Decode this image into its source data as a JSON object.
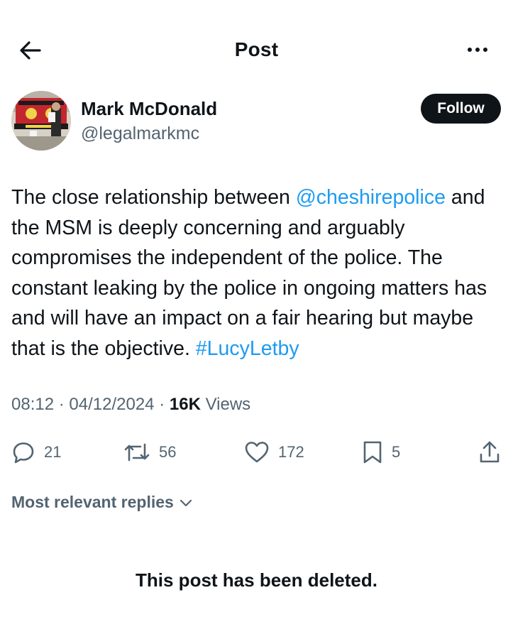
{
  "header": {
    "title": "Post",
    "back_icon": "arrow-left-icon",
    "more_icon": "more-horizontal-icon"
  },
  "author": {
    "name": "Mark McDonald",
    "handle": "@legalmarkmc",
    "follow_label": "Follow"
  },
  "post": {
    "text_part1": "The close relationship between ",
    "mention": "@cheshirepolice",
    "text_part2": " and the MSM is deeply concerning and arguably compromises the independent of the police. The constant leaking by the police in ongoing matters has and will have an impact on a fair hearing but maybe that is the objective. ",
    "hashtag": "#LucyLetby",
    "link_color": "#1d9bf0"
  },
  "meta": {
    "time": "08:12",
    "separator": "·",
    "date": "04/12/2024",
    "views_count": "16K",
    "views_label": "Views"
  },
  "actions": {
    "replies": "21",
    "reposts": "56",
    "likes": "172",
    "bookmarks": "5",
    "reply_icon": "reply-icon",
    "repost_icon": "repost-icon",
    "like_icon": "heart-icon",
    "bookmark_icon": "bookmark-icon",
    "share_icon": "share-icon"
  },
  "replies_sort": {
    "label": "Most relevant replies",
    "icon": "chevron-down-icon"
  },
  "deleted_notice": "This post has been deleted."
}
